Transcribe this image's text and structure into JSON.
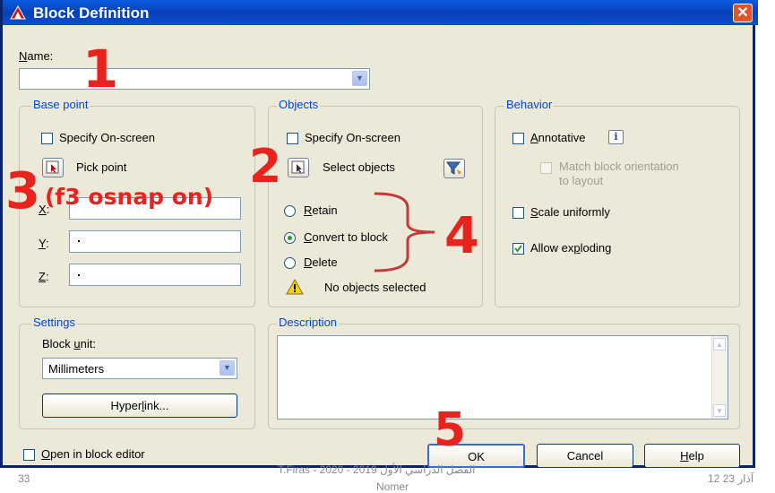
{
  "window": {
    "title": "Block Definition",
    "close_glyph": "✕"
  },
  "name": {
    "label": "Name:",
    "value": ""
  },
  "base_point": {
    "legend": "Base point",
    "specify_onscreen": "Specify On-screen",
    "pick_point": "Pick point",
    "x_label": "X:",
    "x_value": "",
    "y_label": "Y:",
    "y_value": "",
    "z_label": "Z:",
    "z_value": ""
  },
  "objects": {
    "legend": "Objects",
    "specify_onscreen": "Specify On-screen",
    "select_objects": "Select objects",
    "retain": "Retain",
    "convert_to_block": "Convert to block",
    "delete": "Delete",
    "status": "No objects selected",
    "selected_option": "Convert to block"
  },
  "behavior": {
    "legend": "Behavior",
    "annotative": "Annotative",
    "match_orientation_line1": "Match block orientation",
    "match_orientation_line2": "to layout",
    "scale_uniformly": "Scale uniformly",
    "allow_exploding": "Allow exploding",
    "allow_exploding_checked": true
  },
  "settings": {
    "legend": "Settings",
    "block_unit_label": "Block unit:",
    "block_unit_value": "Millimeters",
    "hyperlink": "Hyperlink..."
  },
  "description": {
    "legend": "Description",
    "value": ""
  },
  "footer": {
    "open_in_editor": "Open in block editor",
    "ok": "OK",
    "cancel": "Cancel",
    "help": "Help"
  },
  "annotations": {
    "n1": "1",
    "n2": "2",
    "n3": "3",
    "n3_note": "(f3 osnap on)",
    "n4": "4",
    "n5": "5"
  },
  "slide_footer": {
    "page_left": "33",
    "center_line1": "T.Firas  -  2020 - 2019 الفصل الدراسي الأول",
    "center_line2": "Nomer",
    "right": "12 آذار 23"
  },
  "colors": {
    "title_blue": "#0a4fd4",
    "legend_blue": "#0046d5",
    "annotation_red": "#e8231d",
    "face": "#ece9d8"
  }
}
